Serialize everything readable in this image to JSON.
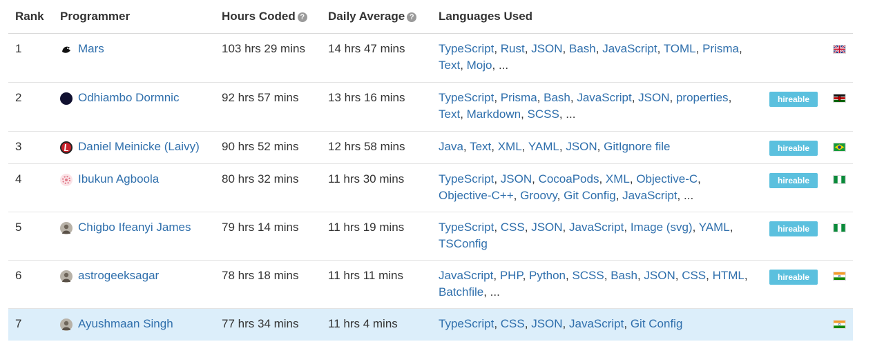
{
  "header": {
    "rank": "Rank",
    "programmer": "Programmer",
    "hours_coded": "Hours Coded",
    "daily_average": "Daily Average",
    "languages_used": "Languages Used",
    "help_glyph": "?"
  },
  "badge_label": "hireable",
  "rows": [
    {
      "rank": "1",
      "name": "Mars",
      "avatar_icon": "bird-logo-avatar",
      "hours": "103 hrs 29 mins",
      "daily": "14 hrs 47 mins",
      "langs": [
        "TypeScript",
        "Rust",
        "JSON",
        "Bash",
        "JavaScript",
        "TOML",
        "Prisma",
        "Text",
        "Mojo"
      ],
      "ellipsis": "...",
      "hireable": false,
      "flag": "uk-flag-icon"
    },
    {
      "rank": "2",
      "name": "Odhiambo Dormnic",
      "avatar_icon": "dark-circle-avatar",
      "hours": "92 hrs 57 mins",
      "daily": "13 hrs 16 mins",
      "langs": [
        "TypeScript",
        "Prisma",
        "Bash",
        "JavaScript",
        "JSON",
        "properties",
        "Text",
        "Markdown",
        "SCSS"
      ],
      "ellipsis": "...",
      "hireable": true,
      "flag": "kenya-flag-icon"
    },
    {
      "rank": "3",
      "name": "Daniel Meinicke (Laivy)",
      "avatar_icon": "red-logo-avatar",
      "hours": "90 hrs 52 mins",
      "daily": "12 hrs 58 mins",
      "langs": [
        "Java",
        "Text",
        "XML",
        "YAML",
        "JSON",
        "GitIgnore file"
      ],
      "ellipsis": "",
      "hireable": true,
      "flag": "brazil-flag-icon"
    },
    {
      "rank": "4",
      "name": "Ibukun Agboola",
      "avatar_icon": "pink-pattern-avatar",
      "hours": "80 hrs 32 mins",
      "daily": "11 hrs 30 mins",
      "langs": [
        "TypeScript",
        "JSON",
        "CocoaPods",
        "XML",
        "Objective-C",
        "Objective-C++",
        "Groovy",
        "Git Config",
        "JavaScript"
      ],
      "ellipsis": "...",
      "hireable": true,
      "flag": "nigeria-flag-icon"
    },
    {
      "rank": "5",
      "name": "Chigbo Ifeanyi James",
      "avatar_icon": "photo-avatar",
      "hours": "79 hrs 14 mins",
      "daily": "11 hrs 19 mins",
      "langs": [
        "TypeScript",
        "CSS",
        "JSON",
        "JavaScript",
        "Image (svg)",
        "YAML",
        "TSConfig"
      ],
      "ellipsis": "",
      "hireable": true,
      "flag": "nigeria-flag-icon"
    },
    {
      "rank": "6",
      "name": "astrogeeksagar",
      "avatar_icon": "photo-avatar",
      "hours": "78 hrs 18 mins",
      "daily": "11 hrs 11 mins",
      "langs": [
        "JavaScript",
        "PHP",
        "Python",
        "SCSS",
        "Bash",
        "JSON",
        "CSS",
        "HTML",
        "Batchfile"
      ],
      "ellipsis": "...",
      "hireable": true,
      "flag": "india-flag-icon"
    },
    {
      "rank": "7",
      "name": "Ayushmaan Singh",
      "avatar_icon": "photo-avatar",
      "hours": "77 hrs 34 mins",
      "daily": "11 hrs 4 mins",
      "langs": [
        "TypeScript",
        "CSS",
        "JSON",
        "JavaScript",
        "Git Config"
      ],
      "ellipsis": "",
      "hireable": false,
      "flag": "india-flag-icon"
    }
  ],
  "colors": {
    "link": "#2f6fac",
    "badge": "#5bc0de",
    "highlight_row": "#dceefa"
  }
}
